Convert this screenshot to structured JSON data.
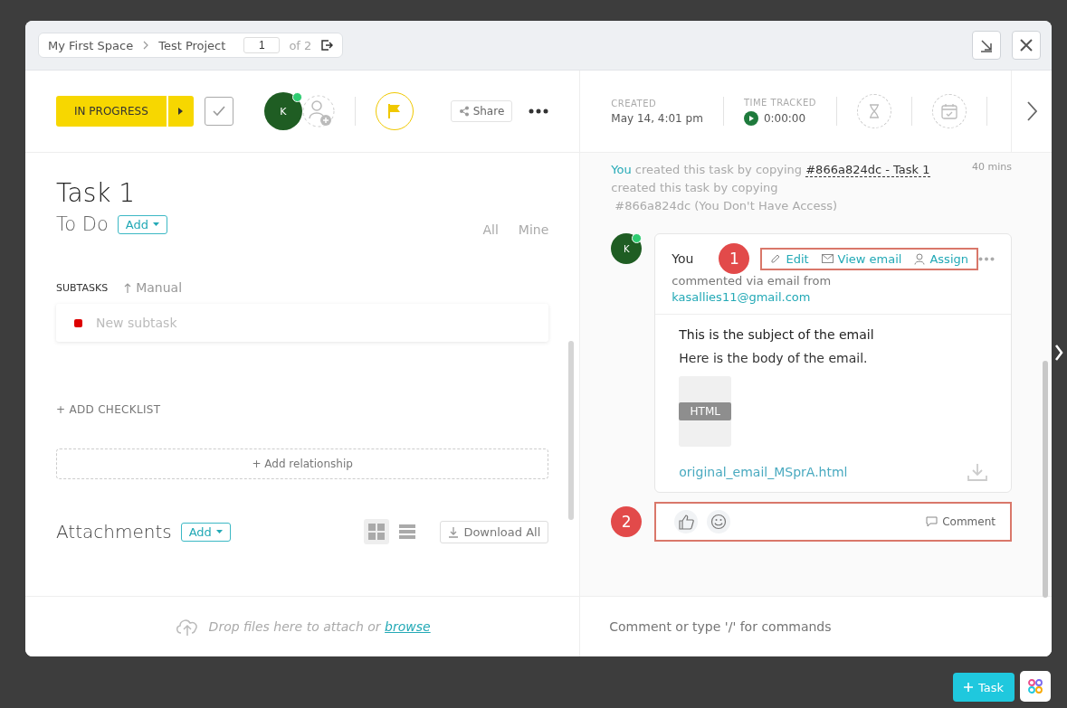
{
  "breadcrumb": {
    "items": [
      "My First Space",
      "Test Project"
    ],
    "page": "1",
    "page_total": "of 2"
  },
  "status": {
    "label": "IN PROGRESS"
  },
  "assignee": {
    "initial": "K",
    "online": true
  },
  "share_label": "Share",
  "title": "Task 1",
  "todo": {
    "label": "To Do",
    "add": "Add",
    "filters": [
      {
        "label": "All",
        "selected": false
      },
      {
        "label": "Mine",
        "selected": false
      }
    ]
  },
  "subtasks": {
    "heading": "SUBTASKS",
    "sort": "Manual",
    "placeholder": "New subtask"
  },
  "add_checklist": "+ ADD CHECKLIST",
  "add_relationship": "+ Add relationship",
  "attachments": {
    "heading": "Attachments",
    "add": "Add",
    "views": [
      {
        "kind": "grid",
        "selected": true
      },
      {
        "kind": "list",
        "selected": false
      }
    ],
    "download": "Download All"
  },
  "drop": {
    "text": "Drop files here to attach or",
    "link": "browse"
  },
  "meta": {
    "created_label": "CREATED",
    "created": "May 14, 4:01 pm",
    "time_label": "TIME TRACKED",
    "time": "0:00:00"
  },
  "activity": {
    "actor": "You",
    "text": "created this task by copying",
    "ref": "#866a824dc - Task 1",
    "time": "40 mins",
    "line2": "created this task by copying",
    "line3": "#866a824dc (You Don't Have Access)"
  },
  "comment": {
    "initial": "K",
    "online": true,
    "author": "You",
    "actions": [
      {
        "kind": "edit",
        "label": "Edit"
      },
      {
        "kind": "email",
        "label": "View email"
      },
      {
        "kind": "assign",
        "label": "Assign"
      }
    ],
    "via": "commented via email from",
    "email": "kasallies11@gmail.com",
    "subject": "This is the subject of the email",
    "body": "Here is the body of the email.",
    "file_type": "HTML",
    "file_name": "original_email_MSprA.html",
    "reply": "Comment"
  },
  "annotations": [
    "1",
    "2"
  ],
  "comment_input": {
    "placeholder": "Comment or type '/' for commands"
  },
  "fab": {
    "label": "Task"
  }
}
